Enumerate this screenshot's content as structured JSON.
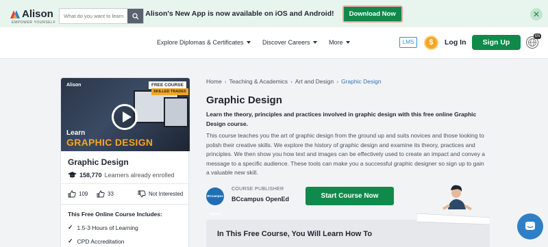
{
  "promo": {
    "text": "Alison's New App is now available on iOS and Android!",
    "button": "Download Now"
  },
  "header": {
    "logo_word": "Alison",
    "logo_tagline": "EMPOWER YOURSELF",
    "search_placeholder": "What do you want to learn",
    "nav": [
      "Explore Diplomas & Certificates",
      "Discover Careers",
      "More"
    ],
    "lms": "LMS",
    "coin": "$",
    "login": "Log In",
    "signup": "Sign Up",
    "lang_badge": "EN"
  },
  "card": {
    "thumb": {
      "logo": "Alison",
      "free_tag": "FREE COURSE",
      "skilled_tag": "SKILLED TRADES",
      "learn": "Learn",
      "subject": "GRAPHIC DESIGN"
    },
    "title": "Graphic Design",
    "enrolled_count": "158,770",
    "enrolled_label": "Learners already enrolled",
    "likes": "109",
    "saves": "33",
    "not_interested": "Not Interested",
    "includes_title": "This Free Online Course Includes:",
    "includes": [
      "1.5-3 Hours of Learning",
      "CPD Accreditation"
    ]
  },
  "breadcrumb": [
    "Home",
    "Teaching & Academics",
    "Art and Design",
    "Graphic Design"
  ],
  "main": {
    "title": "Graphic Design",
    "lead": "Learn the theory, principles and practices involved in graphic design with this free online Graphic Design course.",
    "description": "This course teaches you the art of graphic design from the ground up and suits novices and those looking to polish their creative skills. We explore the history of graphic design and examine its theory, practices and principles. We then show you how text and images can be effectively used to create an impact and convey a message to a specific audience. These tools can make you a successful graphic designer so sign up to gain a valuable new skill.",
    "publisher_label": "COURSE PUBLISHER",
    "publisher_name": "BCcampus OpenEd",
    "publisher_logo_text": "BCcampus OpenEd",
    "start_button": "Start Course Now",
    "learn_title": "In This Free Course, You Will Learn How To"
  },
  "colors": {
    "brand_green": "#0f8a4b",
    "link_blue": "#2f77b8",
    "accent_orange": "#f5a623"
  }
}
